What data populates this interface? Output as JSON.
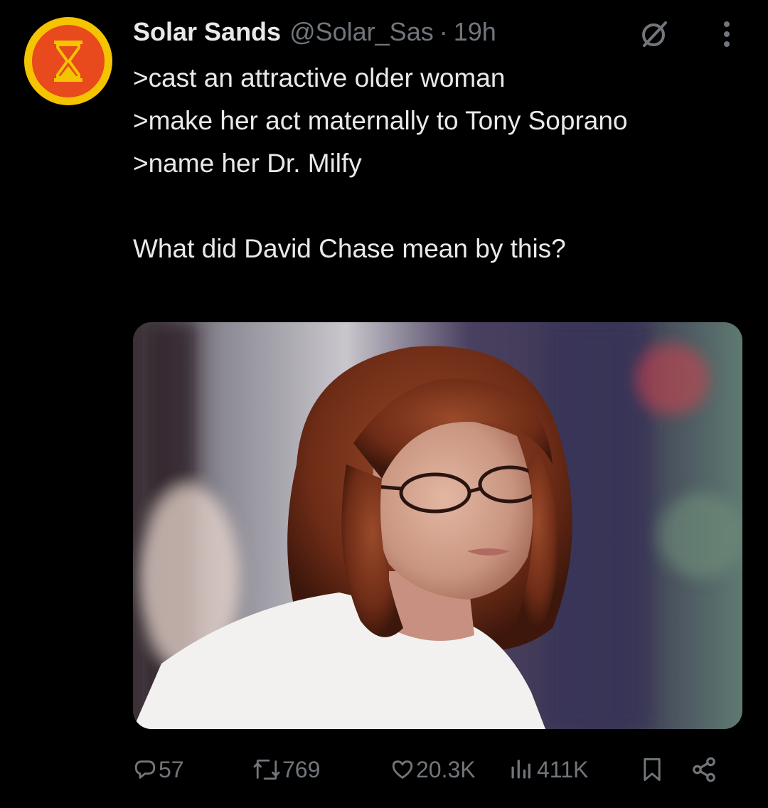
{
  "tweet": {
    "author": {
      "display_name": "Solar Sands",
      "handle": "@Solar_Sas",
      "avatar_icon": "hourglass-icon",
      "avatar_colors": {
        "ring": "#f5c400",
        "fill": "#e8491d"
      }
    },
    "separator": "·",
    "timestamp": "19h",
    "text_lines": [
      ">cast an attractive older woman",
      ">make her act maternally to Tony Soprano",
      ">name her Dr. Milfy",
      "",
      "What did David Chase mean by this?"
    ],
    "media": {
      "kind": "photo",
      "subject": "woman with auburn hair and glasses in a white shirt"
    },
    "metrics": {
      "replies": "57",
      "reposts": "769",
      "likes": "20.3K",
      "views": "411K"
    },
    "icons": {
      "grok": "grok-icon",
      "more": "more-icon",
      "reply": "reply-icon",
      "repost": "repost-icon",
      "like": "heart-icon",
      "views": "views-icon",
      "bookmark": "bookmark-icon",
      "share": "share-icon"
    }
  },
  "colors": {
    "background": "#000000",
    "text_primary": "#e7e9ea",
    "text_secondary": "#71767b"
  }
}
